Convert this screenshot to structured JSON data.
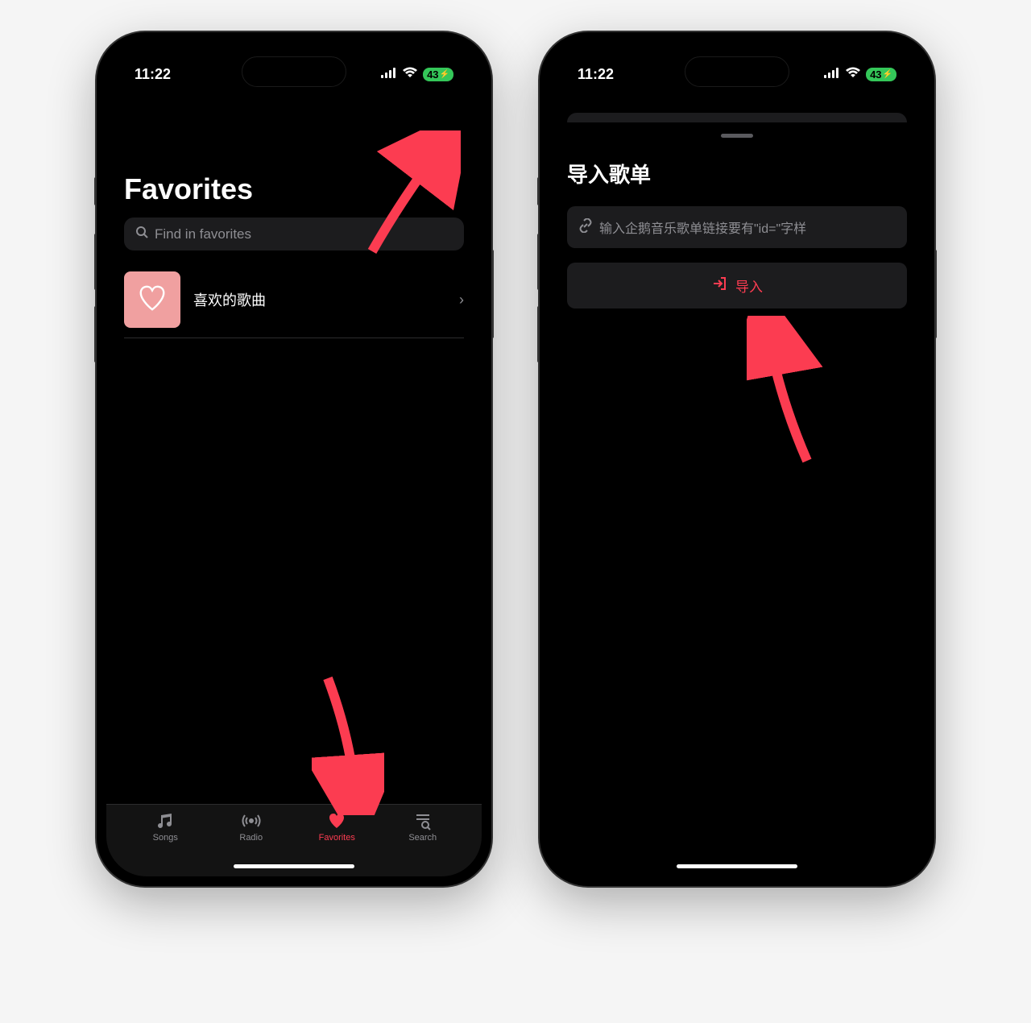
{
  "status": {
    "time": "11:22",
    "battery": "43"
  },
  "favorites": {
    "title": "Favorites",
    "search_placeholder": "Find in favorites",
    "item_label": "喜欢的歌曲"
  },
  "tabs": {
    "songs": "Songs",
    "radio": "Radio",
    "favorites": "Favorites",
    "search": "Search"
  },
  "sheet": {
    "title": "导入歌单",
    "input_placeholder": "输入企鹅音乐歌单链接要有\"id=\"字样",
    "import_label": "导入"
  }
}
